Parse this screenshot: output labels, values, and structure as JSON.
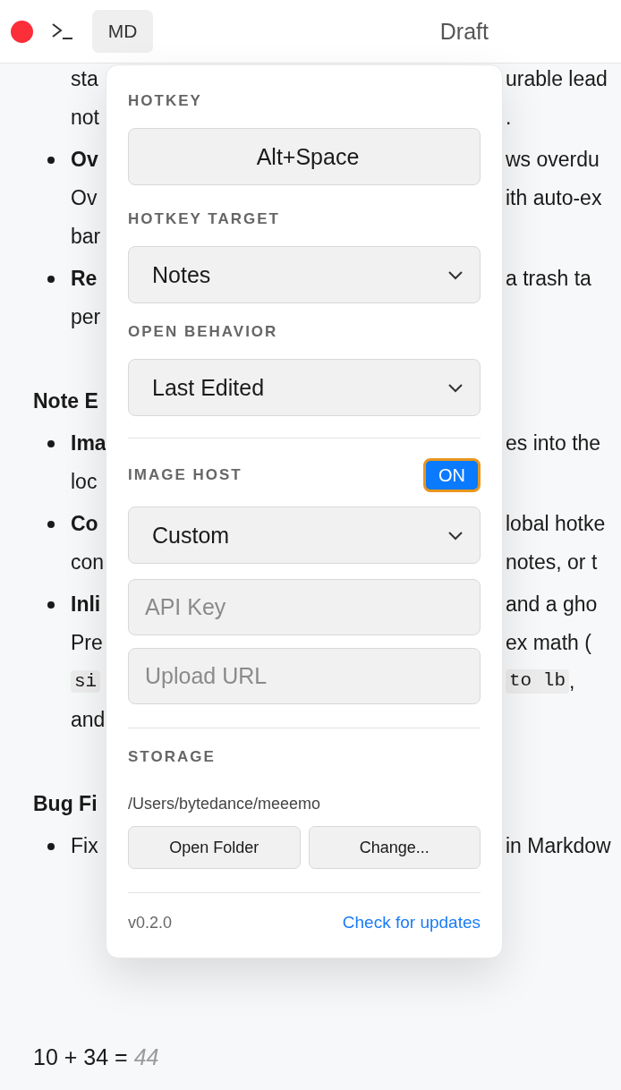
{
  "toolbar": {
    "mode": "MD",
    "title": "Draft"
  },
  "document": {
    "lines": [
      {
        "kind": "cont",
        "left": [
          {
            "text": "sta",
            "kind": "plain"
          }
        ],
        "right": [
          {
            "text": "urable lead",
            "kind": "plain"
          }
        ]
      },
      {
        "kind": "cont",
        "left": [
          {
            "text": "not",
            "kind": "plain"
          }
        ],
        "right": [
          {
            "text": ".",
            "kind": "plain"
          }
        ]
      },
      {
        "kind": "bullet",
        "left": [
          {
            "text": "Ov",
            "kind": "bold"
          }
        ],
        "right": [
          {
            "text": "ws overdu",
            "kind": "plain"
          }
        ]
      },
      {
        "kind": "cont",
        "left": [
          {
            "text": "Ov",
            "kind": "plain"
          }
        ],
        "right": [
          {
            "text": "ith auto-ex",
            "kind": "plain"
          }
        ]
      },
      {
        "kind": "cont",
        "left": [
          {
            "text": "bar",
            "kind": "plain"
          }
        ]
      },
      {
        "kind": "bullet",
        "left": [
          {
            "text": "Re",
            "kind": "bold"
          }
        ],
        "right": [
          {
            "text": "a trash ta",
            "kind": "plain"
          }
        ]
      },
      {
        "kind": "cont",
        "left": [
          {
            "text": "per",
            "kind": "plain"
          }
        ]
      },
      {
        "kind": "heading",
        "left": [
          {
            "text": "Note E",
            "kind": "bold"
          }
        ]
      },
      {
        "kind": "bullet",
        "left": [
          {
            "text": "Ima",
            "kind": "bold"
          }
        ],
        "right": [
          {
            "text": "es into the",
            "kind": "plain"
          }
        ]
      },
      {
        "kind": "cont",
        "left": [
          {
            "text": "loc",
            "kind": "plain"
          }
        ]
      },
      {
        "kind": "bullet",
        "left": [
          {
            "text": "Co",
            "kind": "bold"
          }
        ],
        "right": [
          {
            "text": "lobal hotke",
            "kind": "plain"
          }
        ]
      },
      {
        "kind": "cont",
        "left": [
          {
            "text": "con",
            "kind": "plain"
          }
        ],
        "right": [
          {
            "text": "notes, or t",
            "kind": "plain"
          }
        ]
      },
      {
        "kind": "bullet",
        "left": [
          {
            "text": "Inli",
            "kind": "bold"
          }
        ],
        "right": [
          {
            "text": "and a gho",
            "kind": "plain"
          }
        ]
      },
      {
        "kind": "cont",
        "left": [
          {
            "text": "Pre",
            "kind": "plain"
          }
        ],
        "right": [
          {
            "text": "ex math (",
            "kind": "plain"
          }
        ]
      },
      {
        "kind": "cont",
        "left": [
          {
            "text": "si",
            "kind": "code"
          }
        ],
        "right": [
          {
            "text": "to lb",
            "kind": "code"
          },
          {
            "text": ",",
            "kind": "plain"
          }
        ]
      },
      {
        "kind": "cont",
        "left": [
          {
            "text": "and",
            "kind": "plain"
          }
        ]
      },
      {
        "kind": "heading",
        "left": [
          {
            "text": "Bug Fi",
            "kind": "bold"
          }
        ]
      },
      {
        "kind": "bullet",
        "left": [
          {
            "text": "Fix",
            "kind": "plain"
          }
        ],
        "right": [
          {
            "text": "in Markdow",
            "kind": "plain"
          }
        ]
      }
    ],
    "formula": {
      "expression": "10 + 34 =",
      "result": "44"
    }
  },
  "settings": {
    "hotkey": {
      "label": "HOTKEY",
      "value": "Alt+Space"
    },
    "hotkey_target": {
      "label": "HOTKEY TARGET",
      "value": "Notes"
    },
    "open_behavior": {
      "label": "OPEN BEHAVIOR",
      "value": "Last Edited"
    },
    "image_host": {
      "label": "IMAGE HOST",
      "on": true,
      "focused": true,
      "toggle_label": "ON",
      "provider": "Custom",
      "api_key_placeholder": "API Key",
      "upload_url_placeholder": "Upload URL"
    },
    "storage": {
      "label": "STORAGE",
      "path": "/Users/bytedance/meeemo",
      "buttons": [
        "Open Folder",
        "Change..."
      ]
    },
    "footer": {
      "version": "v0.2.0",
      "link": "Check for updates"
    }
  }
}
